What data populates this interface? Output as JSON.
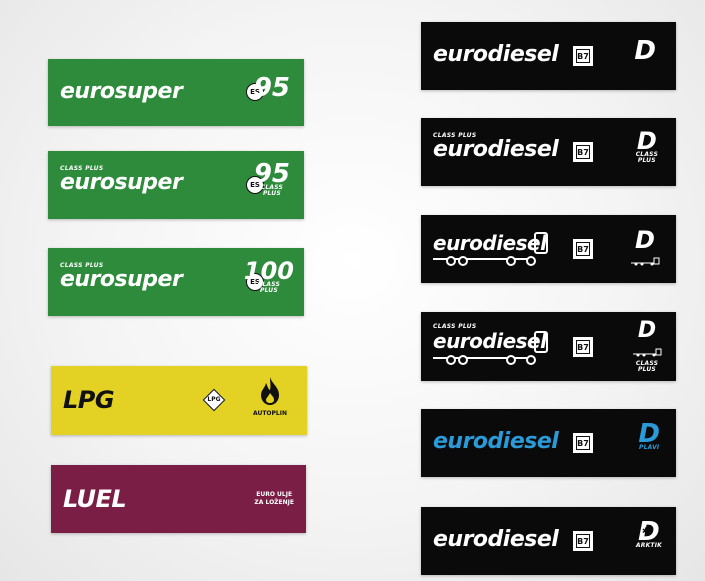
{
  "colors": {
    "eurosuper_green": "#2e8b3c",
    "eurodiesel_black": "#0a0a0a",
    "lpg_yellow": "#e3d224",
    "luel_maroon": "#7a1e45",
    "plavi_blue": "#2a9bd8"
  },
  "left_labels": [
    {
      "brand": "eurosuper",
      "badge": "ES",
      "grade": "95"
    },
    {
      "prefix": "CLASS PLUS",
      "brand": "eurosuper",
      "badge": "ES",
      "grade": "95",
      "grade_sub": "CLASS",
      "grade_sub2": "PLUS"
    },
    {
      "prefix": "CLASS PLUS",
      "brand": "eurosuper",
      "badge": "ES",
      "grade": "100",
      "grade_sub": "CLASS",
      "grade_sub2": "PLUS"
    },
    {
      "brand": "LPG",
      "badge": "LPG",
      "icon": "flame-icon",
      "grade_sub": "AUTOPLIN"
    },
    {
      "brand": "LUEL",
      "note_line1": "EURO ULJE",
      "note_line2": "ZA LOŽENJE"
    }
  ],
  "right_labels": [
    {
      "brand": "eurodiesel",
      "badge": "B7",
      "grade": "D"
    },
    {
      "prefix": "CLASS PLUS",
      "brand": "eurodiesel",
      "badge": "B7",
      "grade": "D",
      "grade_sub": "CLASS",
      "grade_sub2": "PLUS"
    },
    {
      "brand": "eurodiesel",
      "badge": "B7",
      "grade": "D",
      "icon": "truck-icon"
    },
    {
      "prefix": "CLASS PLUS",
      "brand": "eurodiesel",
      "badge": "B7",
      "grade": "D",
      "icon": "truck-icon",
      "grade_sub": "CLASS",
      "grade_sub2": "PLUS"
    },
    {
      "brand": "eurodiesel",
      "badge": "B7",
      "grade": "D",
      "grade_sub": "PLAVI"
    },
    {
      "brand": "eurodiesel",
      "badge": "B7",
      "grade": "D",
      "grade_sub": "ARKTIK",
      "icon": "snowflake-icon"
    }
  ]
}
